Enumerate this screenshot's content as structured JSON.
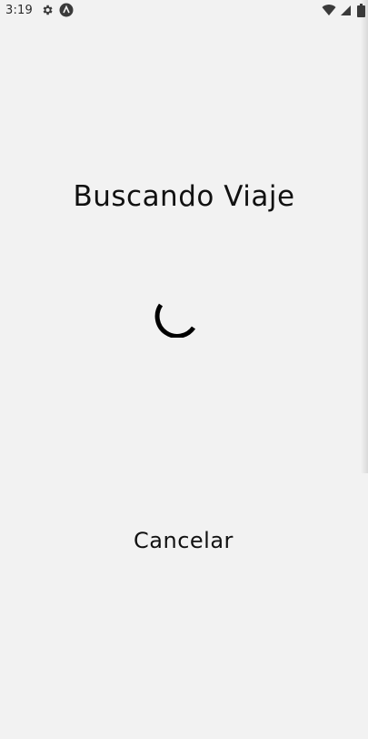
{
  "status_bar": {
    "time": "3:19",
    "icons": [
      "gear-icon",
      "vpn-icon",
      "wifi-icon",
      "signal-icon",
      "battery-icon"
    ]
  },
  "main": {
    "title": "Buscando Viaje",
    "cancel_label": "Cancelar"
  },
  "colors": {
    "background": "#f2f2f2",
    "text": "#111111",
    "spinner": "#000000"
  }
}
